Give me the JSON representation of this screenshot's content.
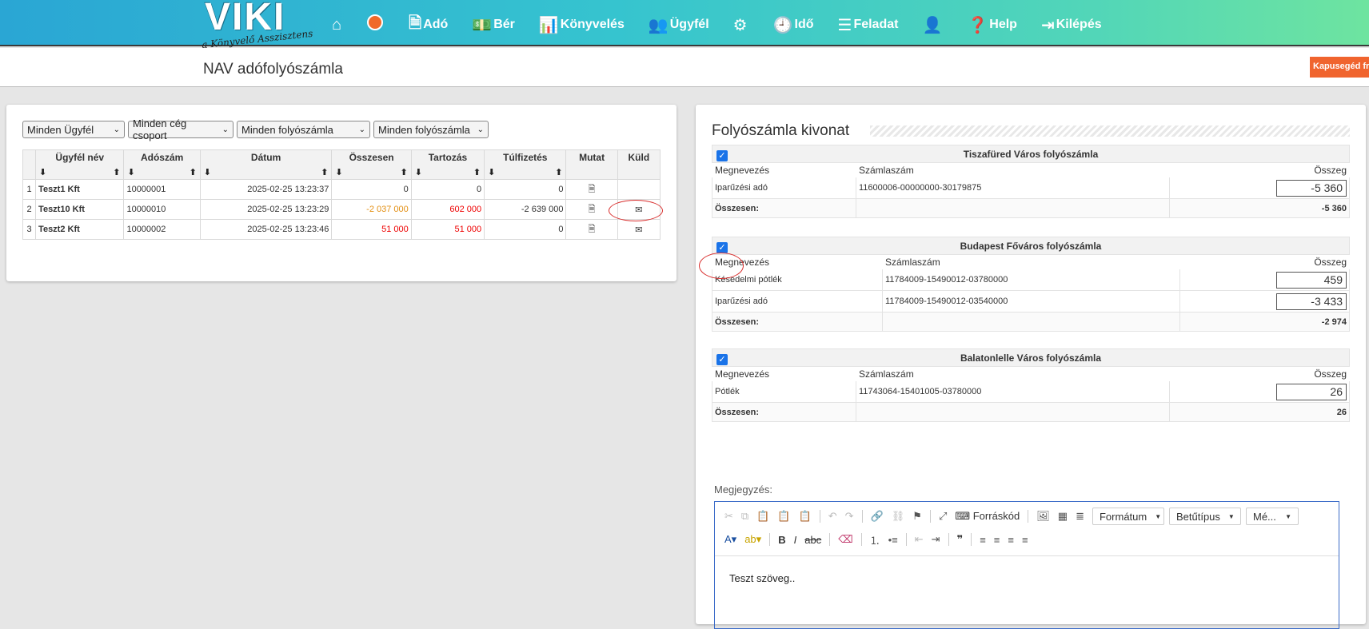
{
  "nav": {
    "logo_main": "VIKI",
    "logo_sub": "a Könyvelő Asszisztens",
    "items": [
      {
        "icon": "home-icon",
        "glyph": "⌂",
        "label": ""
      },
      {
        "icon": "orange-circle-icon",
        "glyph": "",
        "label": ""
      },
      {
        "icon": "document-icon",
        "glyph": "🗎",
        "label": "Adó"
      },
      {
        "icon": "money-icon",
        "glyph": "💵",
        "label": "Bér"
      },
      {
        "icon": "bar-chart-icon",
        "glyph": "📊",
        "label": "Könyvelés"
      },
      {
        "icon": "users-icon",
        "glyph": "👥",
        "label": "Ügyfél"
      },
      {
        "icon": "gears-icon",
        "glyph": "⚙",
        "label": ""
      },
      {
        "icon": "clock-icon",
        "glyph": "🕘",
        "label": "Idő"
      },
      {
        "icon": "list-icon",
        "glyph": "☰",
        "label": "Feladat"
      },
      {
        "icon": "user-icon",
        "glyph": "👤",
        "label": ""
      },
      {
        "icon": "question-icon",
        "glyph": "❓",
        "label": "Help"
      },
      {
        "icon": "logout-icon",
        "glyph": "⇥",
        "label": "Kilépés"
      }
    ]
  },
  "page": {
    "title": "NAV adófolyószámla",
    "kapu_button": "Kapusegéd fri"
  },
  "filters": [
    "Minden Ügyfél",
    "Minden cég csoport",
    "Minden folyószámla",
    "Minden folyószámla"
  ],
  "table": {
    "headers": [
      "Ügyfél név",
      "Adószám",
      "Dátum",
      "Összesen",
      "Tartozás",
      "Túlfizetés",
      "Mutat",
      "Küld"
    ],
    "rows": [
      {
        "no": "1",
        "name": "Teszt1 Kft",
        "tax": "10000001",
        "date": "2025-02-25 13:23:37",
        "total": "0",
        "debt": "0",
        "over": "0",
        "has_mail": false
      },
      {
        "no": "2",
        "name": "Teszt10 Kft",
        "tax": "10000010",
        "date": "2025-02-25 13:23:29",
        "total": "-2 037 000",
        "debt": "602 000",
        "over": "-2 639 000",
        "has_mail": true
      },
      {
        "no": "3",
        "name": "Teszt2 Kft",
        "tax": "10000002",
        "date": "2025-02-25 13:23:46",
        "total": "51 000",
        "debt": "51 000",
        "over": "0",
        "has_mail": true
      }
    ]
  },
  "statement": {
    "title": "Folyószámla kivonat",
    "col_name": "Megnevezés",
    "col_account": "Számlaszám",
    "col_amount": "Összeg",
    "total_label": "Összesen:",
    "accounts": [
      {
        "title": "Tiszafüred Város folyószámla",
        "checked": true,
        "rows": [
          {
            "name": "Iparűzési adó",
            "account": "11600006-00000000-30179875",
            "amount": "-5 360"
          }
        ],
        "total": "-5 360"
      },
      {
        "title": "Budapest Főváros folyószámla",
        "checked": true,
        "rows": [
          {
            "name": "Késedelmi pótlék",
            "account": "11784009-15490012-03780000",
            "amount": "459"
          },
          {
            "name": "Iparűzési adó",
            "account": "11784009-15490012-03540000",
            "amount": "-3 433"
          }
        ],
        "total": "-2 974"
      },
      {
        "title": "Balatonlelle Város folyószámla",
        "checked": true,
        "rows": [
          {
            "name": "Pótlék",
            "account": "11743064-15401005-03780000",
            "amount": "26"
          }
        ],
        "total": "26"
      }
    ]
  },
  "note": {
    "label": "Megjegyzés:",
    "source_button": "Forráskód",
    "format_dropdown": "Formátum",
    "font_dropdown": "Betűtípus",
    "size_dropdown": "Mé...",
    "content": "Teszt szöveg.."
  }
}
